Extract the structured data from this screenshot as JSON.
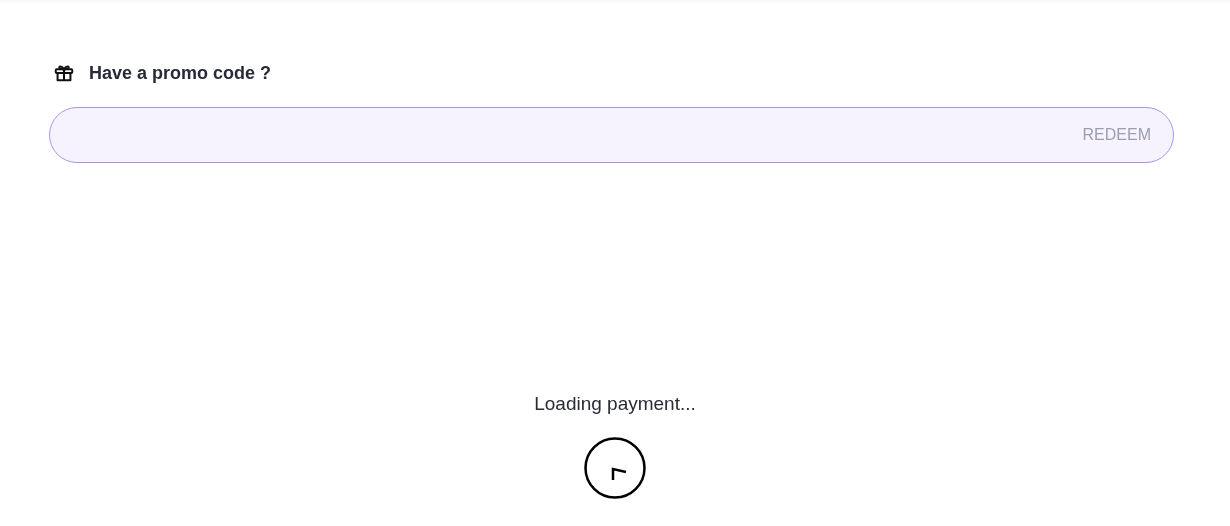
{
  "promo": {
    "title": "Have a promo code ?",
    "button": "REDEEM"
  },
  "loading": {
    "text": "Loading payment..."
  }
}
